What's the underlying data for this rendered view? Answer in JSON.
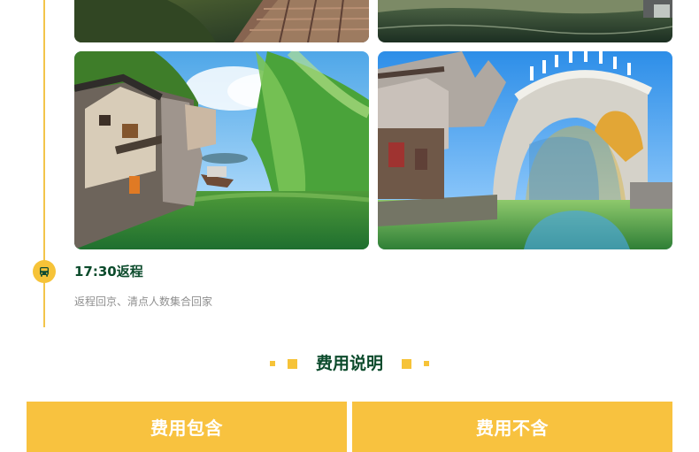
{
  "itinerary": {
    "event": {
      "time_title": "17:30返程",
      "description": "返程回京、清点人数集合回家",
      "icon": "bus-icon"
    },
    "photos": [
      "top-left-cropped-photo",
      "top-right-cropped-photo",
      "water-town-canal-photo",
      "stone-bridge-canal-photo"
    ]
  },
  "cost_section": {
    "title": "费用说明",
    "buttons": {
      "included": "费用包含",
      "excluded": "费用不含"
    }
  },
  "colors": {
    "accent": "#f6c338",
    "title_green": "#0c4b2c",
    "muted_text": "#8f8f8f",
    "button": "#f8c23f"
  }
}
